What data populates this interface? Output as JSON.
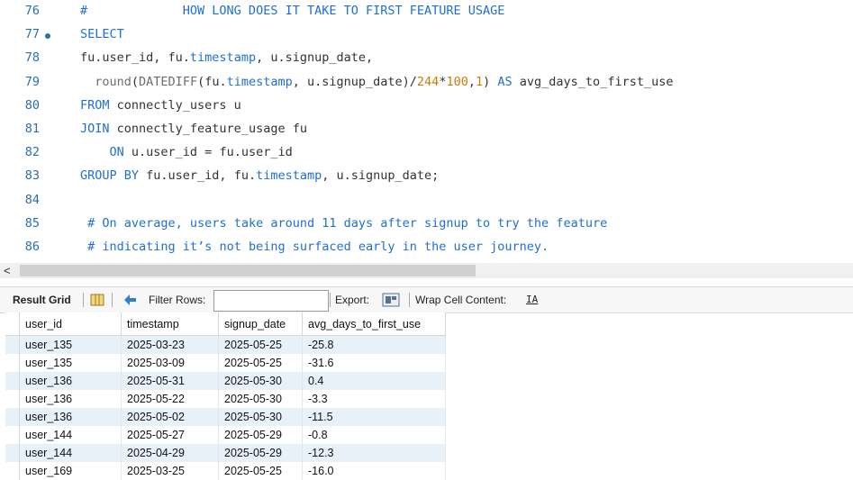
{
  "editor": {
    "lines": [
      {
        "num": "76",
        "marker": false,
        "html": "<span class=\"cm\">#             HOW LONG DOES IT TAKE TO FIRST FEATURE USAGE</span>"
      },
      {
        "num": "77",
        "marker": true,
        "html": "<span class=\"kw\">SELECT</span>"
      },
      {
        "num": "78",
        "marker": false,
        "html": "fu.user_id, fu.<span class=\"kw\">timestamp</span>, u.signup_date,"
      },
      {
        "num": "79",
        "marker": false,
        "html": "  <span class=\"fn\">round</span>(<span class=\"fn\">DATEDIFF</span>(fu.<span class=\"kw\">timestamp</span>, u.signup_date)/<span class=\"num\">244</span>*<span class=\"num\">100</span>,<span class=\"num\">1</span>) <span class=\"kw\">AS</span> avg_days_to_first_use"
      },
      {
        "num": "80",
        "marker": false,
        "html": "<span class=\"kw\">FROM</span> connectly_users u"
      },
      {
        "num": "81",
        "marker": false,
        "html": "<span class=\"kw\">JOIN</span> connectly_feature_usage fu"
      },
      {
        "num": "82",
        "marker": false,
        "html": "    <span class=\"kw\">ON</span> u.user_id = fu.user_id"
      },
      {
        "num": "83",
        "marker": false,
        "html": "<span class=\"kw\">GROUP BY</span> fu.user_id, fu.<span class=\"kw\">timestamp</span>, u.signup_date;"
      },
      {
        "num": "84",
        "marker": false,
        "html": ""
      },
      {
        "num": "85",
        "marker": false,
        "html": " <span class=\"cm\"># On average, users take around 11 days after signup to try the feature</span>"
      },
      {
        "num": "86",
        "marker": false,
        "html": " <span class=\"cm\"># indicating it’s not being surfaced early in the user journey.</span>"
      }
    ]
  },
  "scrollbar": {
    "left_arrow": "<"
  },
  "toolbar": {
    "result_grid_label": "Result Grid",
    "filter_rows_label": "Filter Rows:",
    "filter_value": "",
    "export_label": "Export:",
    "wrap_label": "Wrap Cell Content:",
    "wrap_icon": "IA"
  },
  "grid": {
    "columns": [
      "user_id",
      "timestamp",
      "signup_date",
      "avg_days_to_first_use"
    ],
    "rows": [
      [
        "user_135",
        "2025-03-23",
        "2025-05-25",
        "-25.8"
      ],
      [
        "user_135",
        "2025-03-09",
        "2025-05-25",
        "-31.6"
      ],
      [
        "user_136",
        "2025-05-31",
        "2025-05-30",
        "0.4"
      ],
      [
        "user_136",
        "2025-05-22",
        "2025-05-30",
        "-3.3"
      ],
      [
        "user_136",
        "2025-05-02",
        "2025-05-30",
        "-11.5"
      ],
      [
        "user_144",
        "2025-05-27",
        "2025-05-29",
        "-0.8"
      ],
      [
        "user_144",
        "2025-04-29",
        "2025-05-29",
        "-12.3"
      ],
      [
        "user_169",
        "2025-03-25",
        "2025-05-25",
        "-16.0"
      ]
    ]
  }
}
